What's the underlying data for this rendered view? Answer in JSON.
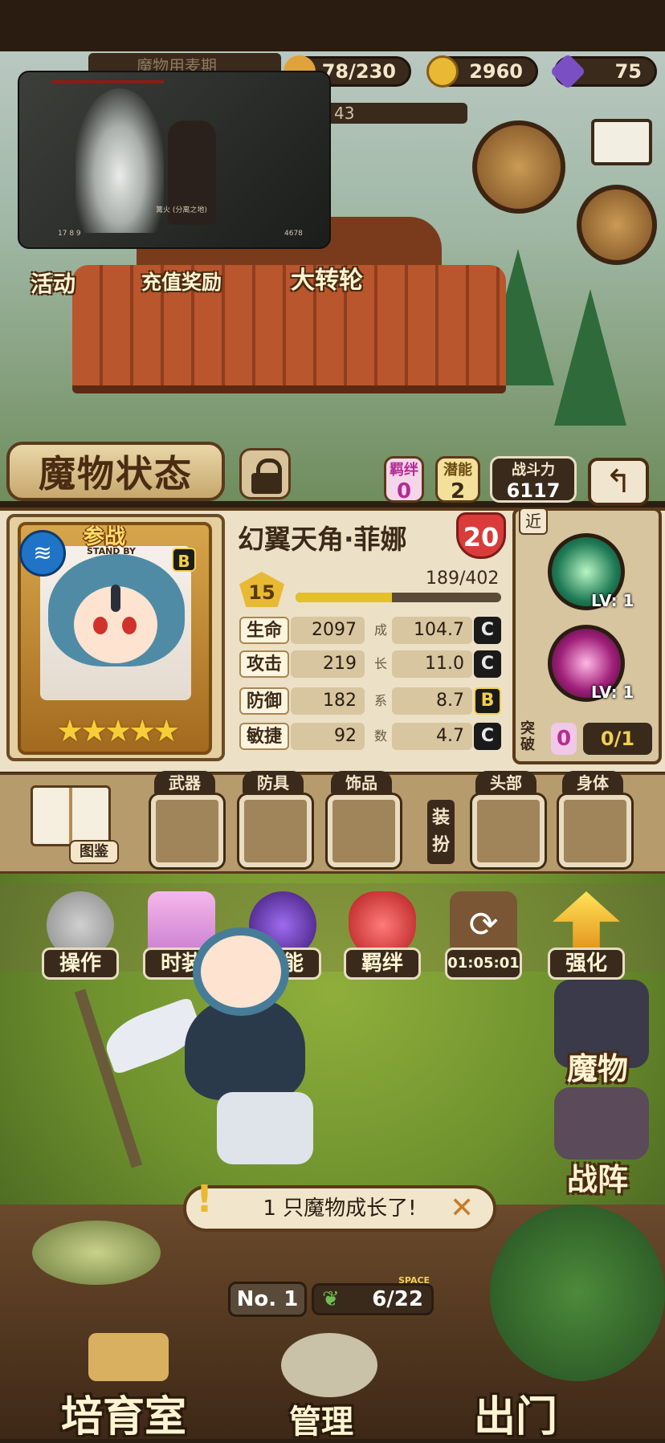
{
  "resources": {
    "stamina": "78/230",
    "gold": "2960",
    "gems": "75",
    "partial_banner": "魔物用麦期",
    "partial_counter": "43"
  },
  "video_overlay": {
    "bottom_left": "17 8 9",
    "bottom_right": "4678",
    "center_text": "篝火 (分离之地)"
  },
  "events": [
    {
      "label": "活动"
    },
    {
      "label": "充值奖励"
    },
    {
      "label": "大转轮"
    }
  ],
  "header": {
    "title": "魔物状态",
    "bond_label": "羁绊",
    "bond_value": "0",
    "potential_label": "潜能",
    "potential_value": "2",
    "power_label": "战斗力",
    "power_value": "6117",
    "back_icon": "return-arrow-icon"
  },
  "monster": {
    "standby": "参战",
    "standby_sub": "STAND BY",
    "element_icon": "water-icon",
    "rank": "B",
    "stars": "★★★★★",
    "name": "幻翼天角·菲娜",
    "shield_level": "20",
    "level": "15",
    "exp_text": "189/402",
    "exp_fraction": 0.47
  },
  "stats": [
    {
      "label": "生命",
      "value": "2097",
      "growth_char": "成",
      "growth": "104.7",
      "grade": "C"
    },
    {
      "label": "攻击",
      "value": "219",
      "growth_char": "长",
      "growth": "11.0",
      "grade": "C"
    },
    {
      "label": "防御",
      "value": "182",
      "growth_char": "系",
      "growth": "8.7",
      "grade": "B"
    },
    {
      "label": "敏捷",
      "value": "92",
      "growth_char": "数",
      "growth": "4.7",
      "grade": "C"
    }
  ],
  "skills": {
    "range": "近",
    "skill1_lv": "LV: 1",
    "skill2_lv": "LV: 1",
    "break_label": "突破",
    "break_value": "0",
    "break_count": "0/1"
  },
  "equipment": {
    "book_label": "图鉴",
    "weapon": "武器",
    "armor": "防具",
    "accessory": "饰品",
    "dress_label": "装扮",
    "head": "头部",
    "body": "身体"
  },
  "actions": [
    {
      "label": "操作"
    },
    {
      "label": "时装"
    },
    {
      "label": "潜能"
    },
    {
      "label": "羁绊"
    },
    {
      "label": "01:05:01"
    },
    {
      "label": "强化"
    }
  ],
  "side_menu": {
    "monsters": "魔物",
    "formation": "战阵"
  },
  "notice": "1 只魔物成长了!",
  "field": {
    "no_label": "No. 1",
    "space_label": "SPACE",
    "space_value": "6/22"
  },
  "bottom_nav": {
    "nursery": "培育室",
    "manage": "管理",
    "exit": "出门"
  },
  "colors": {
    "wood": "#3a2a1c",
    "parchment": "#ece0c6",
    "accent_gold": "#e8b933",
    "accent_red": "#d93c3a"
  }
}
